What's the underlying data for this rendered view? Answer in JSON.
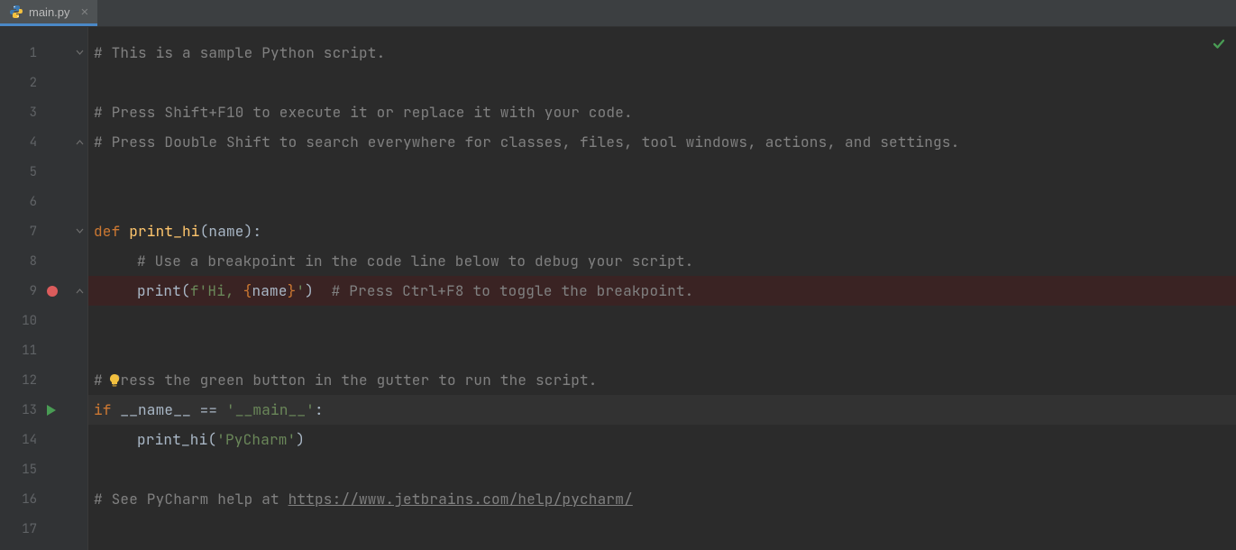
{
  "tab": {
    "filename": "main.py",
    "close_glyph": "×"
  },
  "status": {
    "ok": true
  },
  "lines": [
    {
      "n": 1,
      "fold": "down",
      "tokens": [
        {
          "cls": "c-comment",
          "t": "# This is a sample Python script."
        }
      ]
    },
    {
      "n": 2,
      "tokens": []
    },
    {
      "n": 3,
      "tokens": [
        {
          "cls": "c-comment",
          "t": "# Press Shift+F10 to execute it or replace it with your code."
        }
      ]
    },
    {
      "n": 4,
      "fold": "up",
      "tokens": [
        {
          "cls": "c-comment",
          "t": "# Press Double Shift to search everywhere for classes, files, tool windows, actions, and settings."
        }
      ]
    },
    {
      "n": 5,
      "tokens": []
    },
    {
      "n": 6,
      "tokens": []
    },
    {
      "n": 7,
      "fold": "down",
      "tokens": [
        {
          "cls": "c-kw",
          "t": "def "
        },
        {
          "cls": "c-fn",
          "t": "print_hi"
        },
        {
          "cls": "c-text",
          "t": "(name):"
        }
      ]
    },
    {
      "n": 8,
      "indent": 1,
      "tokens": [
        {
          "cls": "c-comment",
          "t": "# Use a breakpoint in the code line below to debug your script."
        }
      ]
    },
    {
      "n": 9,
      "indent": 1,
      "breakpoint": true,
      "fold": "up",
      "tokens": [
        {
          "cls": "c-text",
          "t": "print("
        },
        {
          "cls": "c-str",
          "t": "f'Hi, "
        },
        {
          "cls": "c-brace",
          "t": "{"
        },
        {
          "cls": "c-text",
          "t": "name"
        },
        {
          "cls": "c-brace",
          "t": "}"
        },
        {
          "cls": "c-str",
          "t": "'"
        },
        {
          "cls": "c-text",
          "t": ")  "
        },
        {
          "cls": "c-comment",
          "t": "# Press Ctrl+F8 to toggle the breakpoint."
        }
      ]
    },
    {
      "n": 10,
      "tokens": []
    },
    {
      "n": 11,
      "tokens": []
    },
    {
      "n": 12,
      "lightbulb": true,
      "tokens": [
        {
          "cls": "c-comment",
          "t": "# Press the green button in the gutter to run the script."
        }
      ]
    },
    {
      "n": 13,
      "run": true,
      "current": true,
      "tokens": [
        {
          "cls": "c-kw",
          "t": "if "
        },
        {
          "cls": "c-text",
          "t": "__name__ == "
        },
        {
          "cls": "c-str",
          "t": "'__main__'"
        },
        {
          "cls": "c-text",
          "t": ":"
        }
      ]
    },
    {
      "n": 14,
      "indent": 1,
      "tokens": [
        {
          "cls": "c-text",
          "t": "print_hi("
        },
        {
          "cls": "c-str",
          "t": "'PyCharm'"
        },
        {
          "cls": "c-text",
          "t": ")"
        }
      ]
    },
    {
      "n": 15,
      "tokens": []
    },
    {
      "n": 16,
      "tokens": [
        {
          "cls": "c-comment",
          "t": "# See PyCharm help at "
        },
        {
          "cls": "c-comment underline",
          "t": "https://www.jetbrains.com/help/pycharm/"
        }
      ]
    },
    {
      "n": 17,
      "tokens": []
    }
  ],
  "lineHeight": 33,
  "firstLineTop": 12
}
